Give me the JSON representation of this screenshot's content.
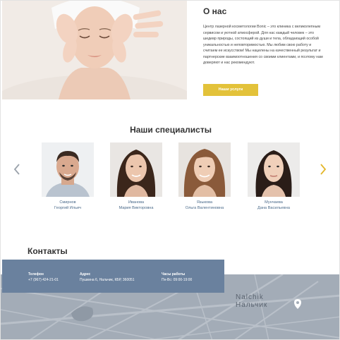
{
  "about": {
    "title": "О нас",
    "text": "Центр лазерной косметологии Bonic – это клиника с великолепным сервисом и уютной атмосферой. Для нас каждый человек – это шедевр природы, состоящий из души и тела, обладающий особой уникальностью и неповторимостью. Мы любим свою работу и считаем ее искусством! Мы нацелены на качественный результат и партнерские взаимоотношения со своими клиентами, и поэтому нам доверяют и нас рекомендуют.",
    "button_label": "Наши услуги"
  },
  "specialists": {
    "title": "Наши специалисты",
    "prev_icon": "chevron-left-icon",
    "next_icon": "chevron-right-icon",
    "items": [
      {
        "surname": "Смирнов",
        "name": "Георгий Ильич"
      },
      {
        "surname": "Иванова",
        "name": "Мария Викторовна"
      },
      {
        "surname": "Языкова",
        "name": "Ольга Валентиновна"
      },
      {
        "surname": "Мунчаева",
        "name": "Дана Васильевна"
      }
    ]
  },
  "contacts": {
    "title": "Контакты",
    "phone_label": "Телефон",
    "phone": "+7 (967) 424-21-01",
    "address_label": "Адрес",
    "address": "Пушкина 6, Нальчик, КБР, 360051",
    "hours_label": "Часы работы",
    "hours": "Пн-Вс: 09:00-19:00"
  },
  "map": {
    "city_latin": "Nalchik",
    "city_cyrillic": "Нальчик",
    "pin_icon": "map-pin-icon"
  },
  "colors": {
    "accent": "#e3c23a",
    "contact_bar": "#6a819e",
    "map": "#a3acb7",
    "link": "#4a6a8a"
  }
}
